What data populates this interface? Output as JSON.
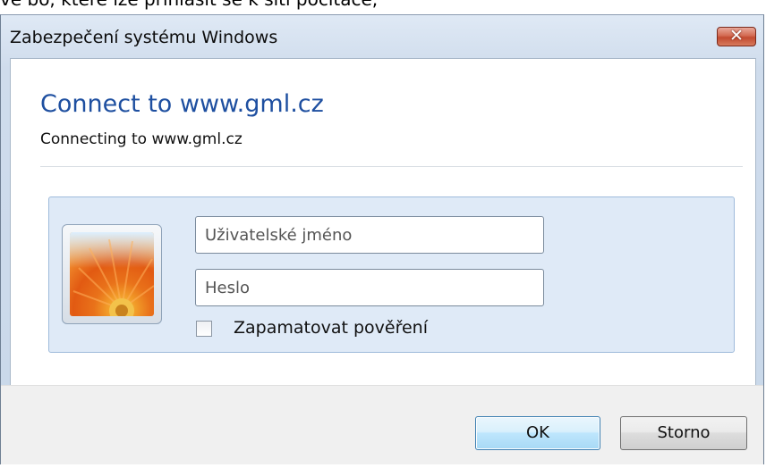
{
  "top_strip_text": "vé bo, které lze přihlásit se k síti počítače,",
  "window": {
    "title": "Zabezpečení systému Windows",
    "close_glyph": "✕"
  },
  "header": {
    "heading": "Connect to www.gml.cz",
    "subtext": "Connecting to www.gml.cz"
  },
  "credentials": {
    "avatar_icon": "user-tile-flower-icon",
    "username_placeholder": "Uživatelské jméno",
    "password_placeholder": "Heslo",
    "remember_label": "Zapamatovat pověření",
    "remember_checked": false
  },
  "buttons": {
    "ok": "OK",
    "cancel": "Storno"
  },
  "colors": {
    "heading": "#1e4fa0",
    "close_button": "#c24a30",
    "tile_background": "#dfeaf7"
  }
}
